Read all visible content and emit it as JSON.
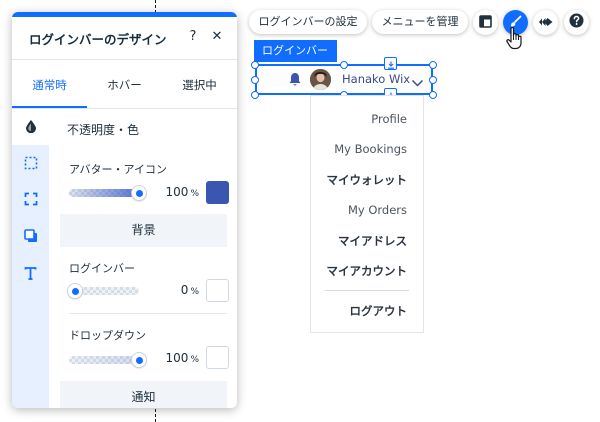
{
  "panel": {
    "title": "ログインバーのデザイン",
    "help_label": "?",
    "close_label": "✕",
    "tabs": [
      {
        "label": "通常時",
        "active": true
      },
      {
        "label": "ホバー",
        "active": false
      },
      {
        "label": "選択中",
        "active": false
      }
    ],
    "rail_icons": [
      "drop-icon",
      "dashed-square-icon",
      "corners-icon",
      "shadow-icon",
      "text-icon"
    ],
    "section_title": "不透明度・色",
    "avatar_icon": {
      "label": "アバター・アイコン",
      "opacity": "100",
      "unit": "%",
      "opacity_fraction": 1.0,
      "color": "#3b56b0"
    },
    "background_group": "背景",
    "login_bar": {
      "label": "ログインバー",
      "opacity": "0",
      "unit": "%",
      "opacity_fraction": 0.0
    },
    "dropdown": {
      "label": "ドロップダウン",
      "opacity": "100",
      "unit": "%",
      "opacity_fraction": 1.0
    },
    "notification_group": "通知"
  },
  "toolbar": {
    "login_settings": "ログインバーの設定",
    "manage_menu": "メニューを管理",
    "icons": [
      "layout-icon",
      "design-brush-icon",
      "animation-icon",
      "help-icon"
    ],
    "accent": "#116dff"
  },
  "widget": {
    "tag": "ログインバー",
    "user_name": "Hanako Wix"
  },
  "dropdown_menu": {
    "items": [
      {
        "label": "Profile",
        "bold": false
      },
      {
        "label": "My Bookings",
        "bold": false
      },
      {
        "label": "マイウォレット",
        "bold": true
      },
      {
        "label": "My Orders",
        "bold": false
      },
      {
        "label": "マイアドレス",
        "bold": true
      },
      {
        "label": "マイアカウント",
        "bold": true
      }
    ],
    "logout": "ログアウト"
  }
}
